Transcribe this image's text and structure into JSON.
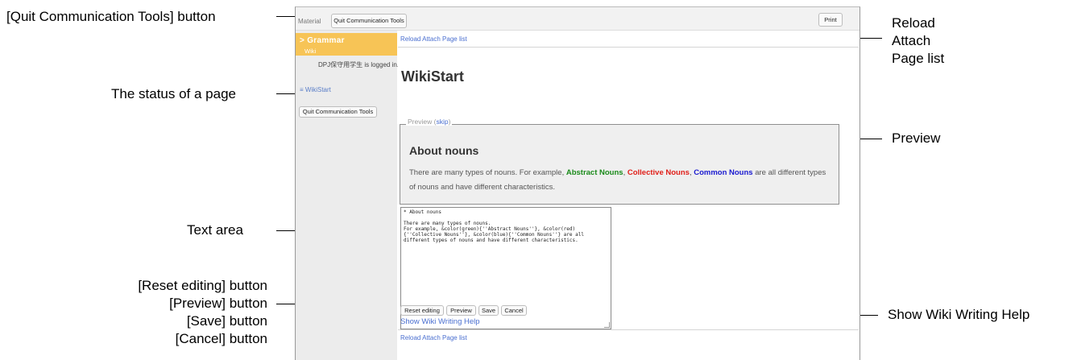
{
  "callouts": {
    "quit_button": "[Quit Communication Tools] button",
    "status": "The status of a page",
    "text_area": "Text area",
    "reset": "[Reset editing] button",
    "preview_btn": "[Preview] button",
    "save": "[Save] button",
    "cancel": "[Cancel] button",
    "reload": "Reload Attach Page list",
    "preview": "Preview",
    "help": "Show Wiki Writing Help"
  },
  "topbar": {
    "material": "Material",
    "quit_tab": "Quit Communication Tools",
    "print": "Print"
  },
  "sidebar": {
    "grammar": "> Grammar",
    "wiki": "Wiki",
    "logged_in": "DPJ保守用学生 is logged in.",
    "page_status": "≡ WikiStart",
    "quit_button": "Quit Communication Tools"
  },
  "main": {
    "reload_top": "Reload Attach Page list",
    "page_title": "WikiStart",
    "preview_legend": "Preview (",
    "skip": "skip",
    "preview_legend_end": ")",
    "preview_heading": "About nouns",
    "preview_text_1": "There are many types of nouns. For example, ",
    "abstract": "Abstract Nouns",
    "comma1": ", ",
    "collective": "Collective Nouns",
    "comma2": ", ",
    "common": "Common Nouns",
    "preview_text_2": " are all different types of nouns and have different characteristics.",
    "textarea_value": "* About nouns\n\nThere are many types of nouns.\nFor example, &color(green){''Abstract Nouns''}, &color(red){''Collective Nouns''}, &color(blue){''Common Nouns''} are all different types of nouns and have different characteristics.",
    "buttons": {
      "reset": "Reset editing",
      "preview": "Preview",
      "save": "Save",
      "cancel": "Cancel"
    },
    "help_link": "Show Wiki Writing Help",
    "reload_bottom": "Reload Attach Page list"
  }
}
